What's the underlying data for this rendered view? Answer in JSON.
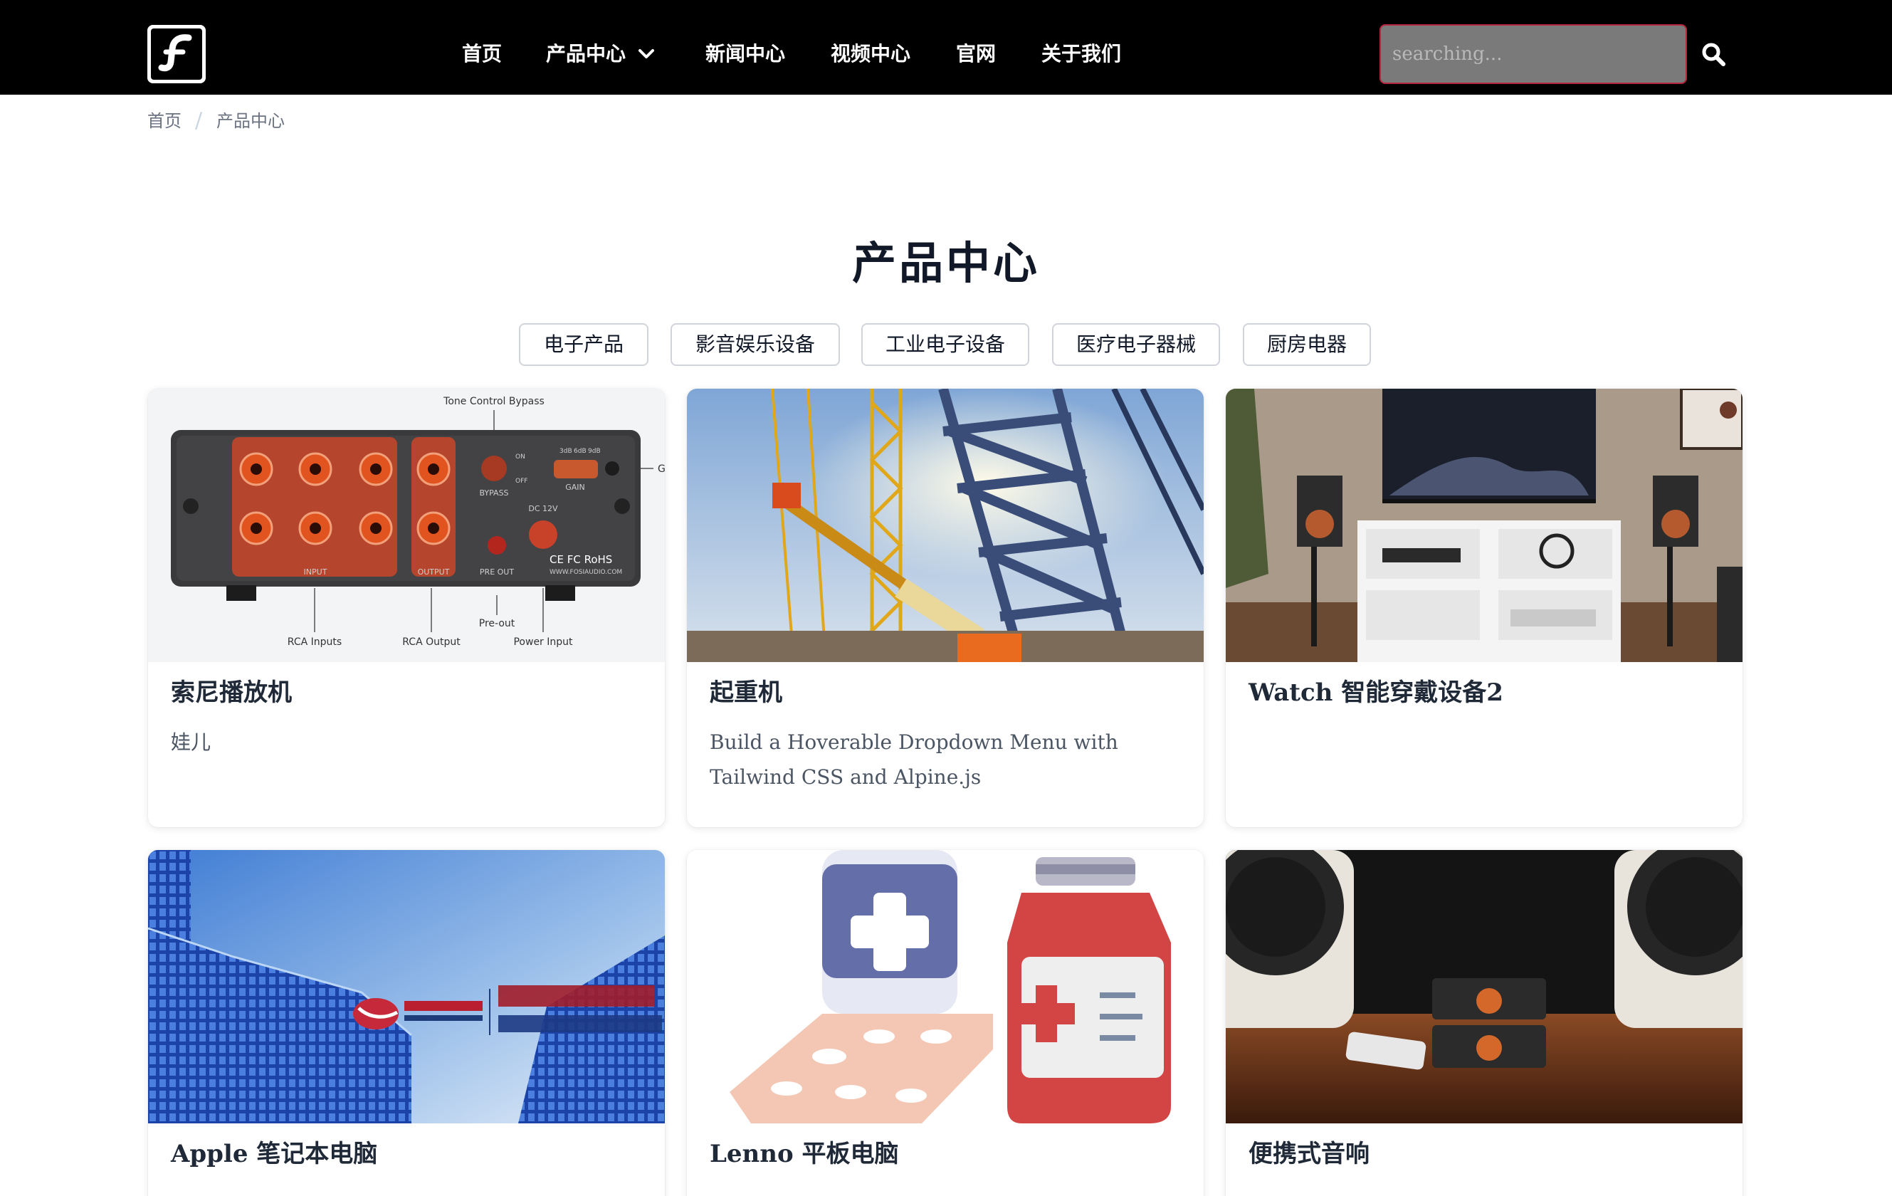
{
  "nav": {
    "logo_alt": "logo",
    "links": [
      "首页",
      "产品中心",
      "新闻中心",
      "视频中心",
      "官网",
      "关于我们"
    ],
    "search_placeholder": "searching..."
  },
  "breadcrumb": [
    "首页",
    "产品中心"
  ],
  "page_title": "产品中心",
  "filters": [
    "电子产品",
    "影音娱乐设备",
    "工业电子设备",
    "医疗电子器械",
    "厨房电器"
  ],
  "product_image_1": {
    "callouts": [
      "Tone Control Bypass",
      "RCA Inputs",
      "RCA Output",
      "Pre-out",
      "Power Input"
    ],
    "panel_labels": [
      "INPUT",
      "OUTPUT",
      "PRE OUT",
      "BYPASS",
      "GAIN",
      "DC 12V",
      "ON",
      "OFF",
      "3dB",
      "6dB",
      "9dB"
    ],
    "marks": "CE FC RoHS",
    "brand": "WWW.FOSIAUDIO.COM"
  },
  "cards": [
    {
      "title": "索尼播放机",
      "desc": "娃儿"
    },
    {
      "title": "起重机",
      "desc": "Build a Hoverable Dropdown Menu with Tailwind CSS and Alpine.js"
    },
    {
      "title": "Watch 智能穿戴设备2",
      "desc": ""
    },
    {
      "title": "Apple 笔记本电脑",
      "desc": ""
    },
    {
      "title": "Lenno 平板电脑",
      "desc": ""
    },
    {
      "title": "便携式音响",
      "desc": ""
    }
  ],
  "colors": {
    "nav_bg": "#000000",
    "search_border": "#b3263c",
    "search_bg": "#7a7a7a",
    "card_bg": "#ffffff"
  }
}
